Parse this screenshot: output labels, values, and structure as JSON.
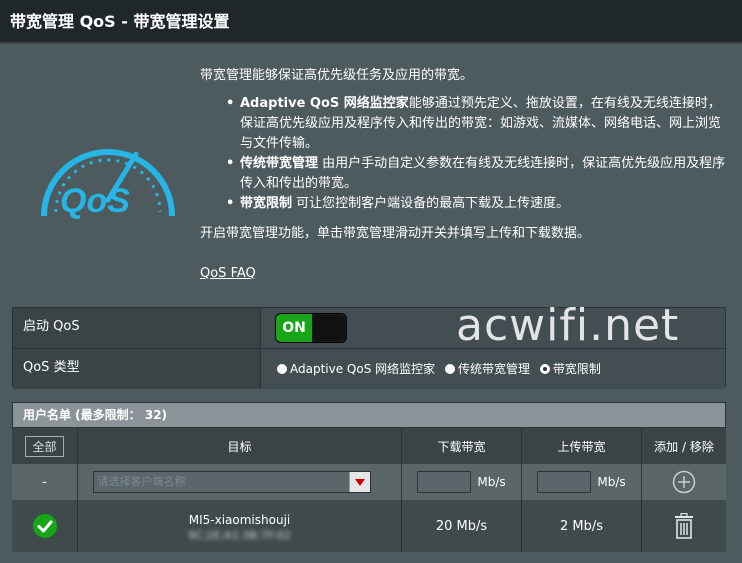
{
  "page": {
    "title": "带宽管理 QoS - 带宽管理设置"
  },
  "intro": {
    "lead": "带宽管理能够保证高优先级任务及应用的带宽。",
    "items": [
      {
        "strong": "Adaptive QoS 网络监控家",
        "text": "能够通过预先定义、拖放设置，在有线及无线连接时，保证高优先级应用及程序传入和传出的带宽：如游戏、流媒体、网络电话、网上浏览与文件传输。"
      },
      {
        "strong": "传统带宽管理",
        "text": " 由用户手动自定义参数在有线及无线连接时，保证高优先级应用及程序传入和传出的带宽。"
      },
      {
        "strong": "带宽限制",
        "text": " 可让您控制客户端设备的最高下载及上传速度。"
      }
    ],
    "tail": "开启带宽管理功能，单击带宽管理滑动开关并填写上传和下载数据。",
    "faq": "QoS FAQ"
  },
  "logo": {
    "text": "QoS"
  },
  "watermark": "acwifi.net",
  "settings": {
    "enable_label": "启动 QoS",
    "toggle_state": "ON",
    "type_label": "QoS 类型",
    "type_options": [
      {
        "label": "Adaptive QoS 网络监控家",
        "checked": false
      },
      {
        "label": "传统带宽管理",
        "checked": false
      },
      {
        "label": "带宽限制",
        "checked": true
      }
    ]
  },
  "user_list": {
    "header": "用户名单 (最多限制： 32)",
    "columns": {
      "all": "全部",
      "target": "目标",
      "download": "下载带宽",
      "upload": "上传带宽",
      "action": "添加 / 移除"
    },
    "input_row": {
      "dash": "-",
      "placeholder": "请选择客户端名称",
      "unit_dl": "Mb/s",
      "unit_ul": "Mb/s"
    },
    "rows": [
      {
        "name": "MI5-xiaomishouji",
        "mac": "9C:2E:A1:3B:7F:02",
        "download": "20 Mb/s",
        "upload": "2 Mb/s"
      }
    ]
  },
  "colors": {
    "accent_green": "#18a518",
    "logo_blue": "#27b4e6"
  }
}
